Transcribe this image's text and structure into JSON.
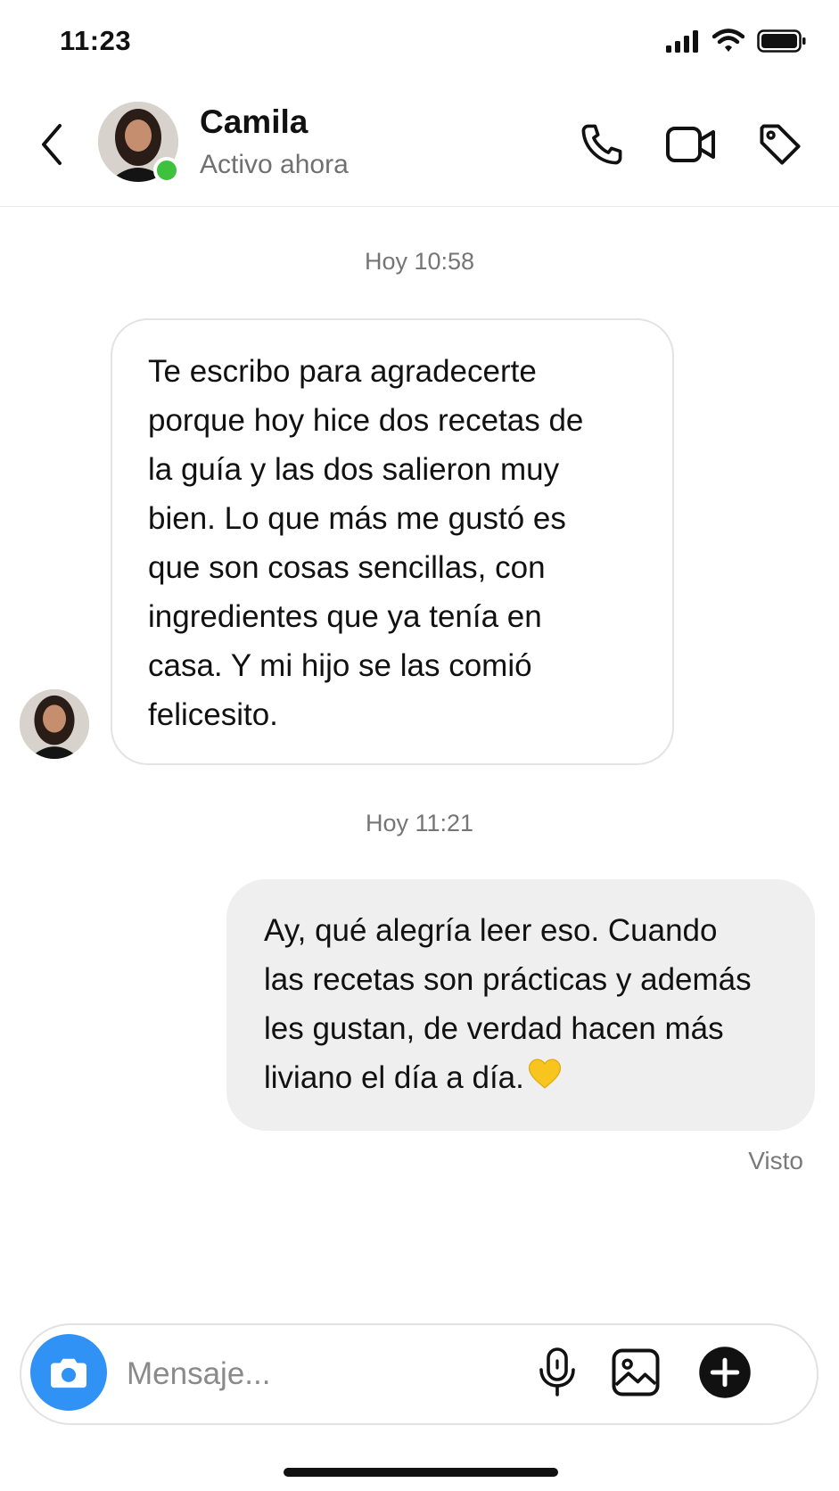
{
  "status_bar": {
    "time": "11:23",
    "icons": [
      "cellular-signal-icon",
      "wifi-icon",
      "battery-icon"
    ]
  },
  "header": {
    "back_icon": "chevron-left-icon",
    "contact_name": "Camila",
    "contact_status": "Activo ahora",
    "actions": [
      "phone-icon",
      "video-call-icon",
      "tag-icon"
    ],
    "online_color": "#3ec23e"
  },
  "conversation": {
    "messages": [
      {
        "timestamp": "Hoy 10:58",
        "direction": "incoming",
        "text": "Te escribo para agradecerte\nporque hoy hice dos recetas de\nla guía y las dos salieron muy\nbien. Lo que más me gustó es\nque son cosas sencillas, con\ningredientes que ya tenía en\ncasa. Y mi hijo se las comió\nfelicesito."
      },
      {
        "timestamp": "Hoy 11:21",
        "direction": "outgoing",
        "text": "Ay, qué alegría leer eso. Cuando\nlas recetas son prácticas y además\nles gustan, de verdad hacen más\nliviano el día a día.",
        "emoji": "yellow-heart-icon"
      }
    ],
    "seen_label": "Visto"
  },
  "composer": {
    "placeholder": "Mensaje...",
    "value": "",
    "camera_color": "#2f92f4",
    "icons": [
      "camera-icon",
      "microphone-icon",
      "gallery-icon",
      "plus-circle-icon"
    ]
  }
}
